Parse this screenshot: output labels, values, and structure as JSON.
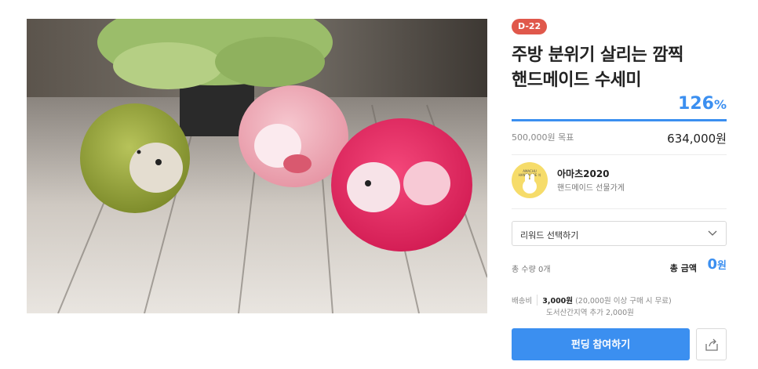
{
  "product": {
    "image_alt": "knitted pom-pom scrubbers",
    "d_day": "D-22",
    "title_line1": "주방 분위기 살리는 깜찍",
    "title_line2": "핸드메이드 수세미"
  },
  "funding": {
    "percent_value": "126",
    "percent_unit": "%",
    "progress_fraction": 1.0,
    "goal": "500,000원 목표",
    "amount": "634,000원"
  },
  "creator": {
    "name": "아마츠2020",
    "description": "핸드메이드 선물가게",
    "avatar_text": "AMACHU HANDMADE 아마츠"
  },
  "reward": {
    "select_label": "리워드 선택하기"
  },
  "order": {
    "quantity": "총 수량 0개",
    "total_label": "총 금액",
    "total_value": "0",
    "total_unit": "원"
  },
  "shipping": {
    "label": "배송비",
    "price": "3,000원",
    "note": "(20,000원 이상 구매 시 무료)",
    "extra": "도서산간지역 추가 2,000원"
  },
  "actions": {
    "fund_label": "펀딩 참여하기"
  },
  "colors": {
    "accent": "#3b8ff0",
    "dday_badge": "#e0584b"
  }
}
